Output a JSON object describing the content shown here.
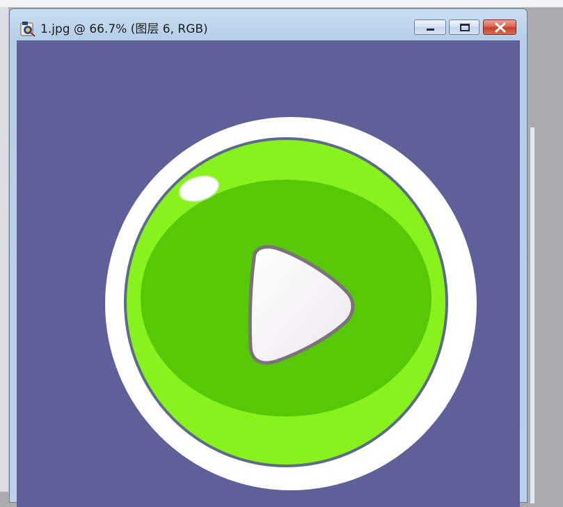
{
  "document": {
    "title": "1.jpg @ 66.7% (图层 6, RGB)",
    "icon": "photoshop-document-icon"
  },
  "window_controls": {
    "minimize_icon": "minimize-icon",
    "maximize_icon": "maximize-icon",
    "close_icon": "close-icon"
  },
  "colors": {
    "canvas_background": "#5f5f99",
    "outer_ring": "#ffffff",
    "button_light_green": "#88f21c",
    "button_dark_green": "#57c805",
    "play_fill": "#f4f2f4",
    "play_stroke": "#7c737a",
    "window_frame": "#b9d1ea",
    "close_button": "#c3412a"
  },
  "canvas": {
    "artwork": "play-button-icon",
    "highlight": "gloss-highlight"
  }
}
